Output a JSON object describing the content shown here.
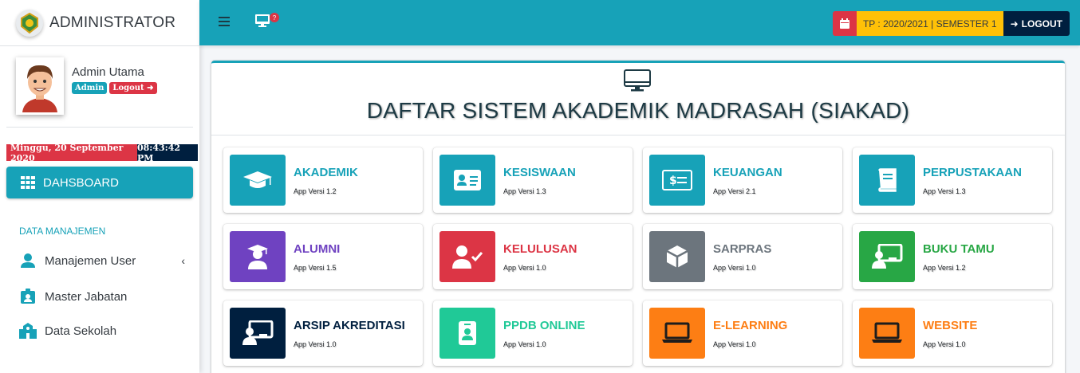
{
  "brand": {
    "title": "ADMINISTRATOR"
  },
  "user": {
    "name": "Admin Utama",
    "role_badge": "Admin",
    "logout_badge": "Logout"
  },
  "datetime": {
    "date": "Minggu, 20 September 2020",
    "time": "08:43:42 PM"
  },
  "sidebar": {
    "dashboard_label": "DAHSBOARD",
    "section_header": "DATA MANAJEMEN",
    "items": [
      {
        "label": "Manajemen User",
        "icon": "user-icon",
        "has_submenu": true
      },
      {
        "label": "Master Jabatan",
        "icon": "id-badge-icon",
        "has_submenu": false
      },
      {
        "label": "Data Sekolah",
        "icon": "school-icon",
        "has_submenu": false
      }
    ]
  },
  "topbar": {
    "notification_count": "?",
    "academic_year": "TP : 2020/2021 | SEMESTER 1",
    "logout_label": "LOGOUT"
  },
  "main": {
    "title": "DAFTAR SISTEM AKADEMIK MADRASAH (SIAKAD)",
    "apps": [
      {
        "name": "AKADEMIK",
        "version": "App Versi 1.2",
        "color": "#17a2b8",
        "icon": "graduation-cap-icon"
      },
      {
        "name": "KESISWAAN",
        "version": "App Versi 1.3",
        "color": "#17a2b8",
        "icon": "id-card-icon"
      },
      {
        "name": "KEUANGAN",
        "version": "App Versi 2.1",
        "color": "#17a2b8",
        "icon": "money-icon"
      },
      {
        "name": "PERPUSTAKAAN",
        "version": "App Versi 1.3",
        "color": "#17a2b8",
        "icon": "book-icon"
      },
      {
        "name": "ALUMNI",
        "version": "App Versi 1.5",
        "color": "#6f42c1",
        "icon": "user-graduate-icon"
      },
      {
        "name": "KELULUSAN",
        "version": "App Versi 1.0",
        "color": "#dc3545",
        "icon": "user-check-icon"
      },
      {
        "name": "SARPRAS",
        "version": "App Versi 1.0",
        "color": "#6c757d",
        "icon": "box-icon"
      },
      {
        "name": "BUKU TAMU",
        "version": "App Versi 1.2",
        "color": "#28a745",
        "icon": "chalkboard-teacher-icon"
      },
      {
        "name": "ARSIP AKREDITASI",
        "version": "App Versi 1.0",
        "color": "#001f3f",
        "icon": "chalkboard-teacher-icon"
      },
      {
        "name": "PPDB ONLINE",
        "version": "App Versi 1.0",
        "color": "#20c997",
        "icon": "id-badge-icon"
      },
      {
        "name": "E-LEARNING",
        "version": "App Versi 1.0",
        "color": "#fd7e14",
        "icon": "laptop-icon"
      },
      {
        "name": "WEBSITE",
        "version": "App Versi 1.0",
        "color": "#fd7e14",
        "icon": "laptop-icon"
      }
    ]
  }
}
